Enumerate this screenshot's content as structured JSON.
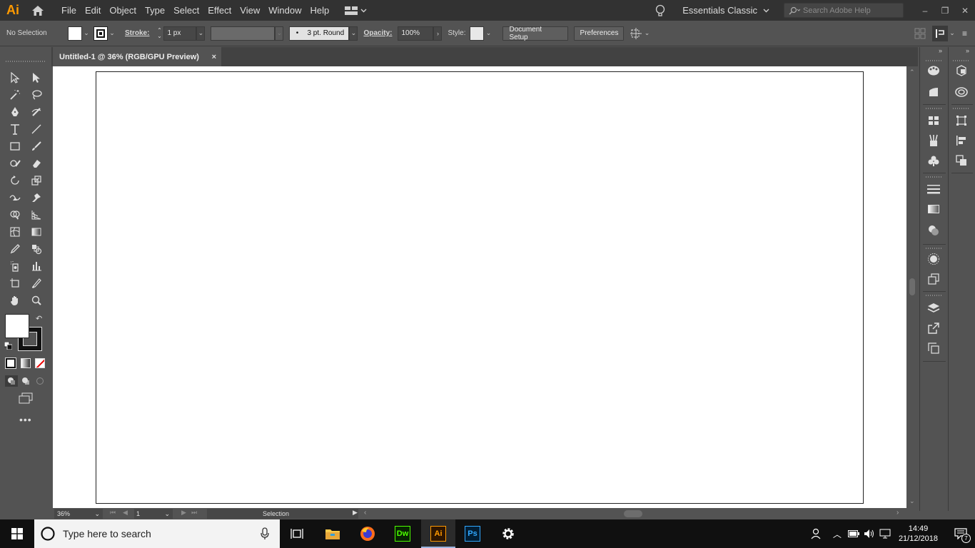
{
  "app": {
    "logo": "Ai",
    "menu": [
      "File",
      "Edit",
      "Object",
      "Type",
      "Select",
      "Effect",
      "View",
      "Window",
      "Help"
    ],
    "workspace": "Essentials Classic",
    "search_placeholder": "Search Adobe Help"
  },
  "control": {
    "selection_status": "No Selection",
    "stroke_label": "Stroke:",
    "stroke_weight": "1 px",
    "brush": "3 pt. Round",
    "brush_dot": "•",
    "opacity_label": "Opacity:",
    "opacity_value": "100%",
    "style_label": "Style:",
    "document_setup": "Document Setup",
    "preferences": "Preferences"
  },
  "document": {
    "tab_title": "Untitled-1 @ 36% (RGB/GPU Preview)",
    "close_glyph": "×"
  },
  "status": {
    "zoom": "36%",
    "artboard_number": "1",
    "tool_name": "Selection"
  },
  "taskbar": {
    "search_placeholder": "Type here to search",
    "apps": [
      "File Explorer",
      "Firefox",
      "Dw",
      "Ai",
      "Ps",
      "Settings"
    ],
    "time": "14:49",
    "date": "21/12/2018",
    "notification_count": "7"
  },
  "colors": {
    "ai_orange": "#ff9a00",
    "dw_green": "#4cff00",
    "ps_blue": "#31a8ff",
    "ui_dark": "#323232",
    "ui_mid": "#535353"
  }
}
